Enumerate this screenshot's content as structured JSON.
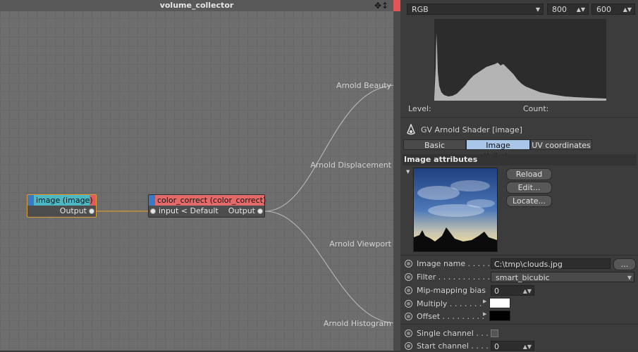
{
  "editor": {
    "title": "volume_collector",
    "outputs": [
      {
        "label": "Arnold Beauty"
      },
      {
        "label": "Arnold Displacement"
      },
      {
        "label": "Arnold Viewport"
      },
      {
        "label": "Arnold Histogram"
      }
    ],
    "nodes": {
      "image": {
        "title": "image (image)",
        "output": "Output"
      },
      "color_correct": {
        "title": "color_correct (color_correct)",
        "input": "input < Default",
        "output": "Output"
      }
    }
  },
  "panel": {
    "channel": "RGB",
    "width": "800",
    "height": "600",
    "level_label": "Level:",
    "count_label": "Count:",
    "shader_title": "GV Arnold Shader [image]",
    "tabs": [
      {
        "label": "Basic"
      },
      {
        "label": "Image attributes",
        "active": true
      },
      {
        "label": "UV coordinates"
      }
    ],
    "section_title": "Image attributes",
    "buttons": {
      "reload": "Reload",
      "edit": "Edit...",
      "locate": "Locate..."
    },
    "params": {
      "image_name": {
        "label": "Image name . . . . . . .",
        "value": "C:\\tmp\\clouds.jpg",
        "browse": "..."
      },
      "filter": {
        "label": "Filter . . . . . . . . . . . . .",
        "value": "smart_bicubic"
      },
      "mip_bias": {
        "label": "Mip-mapping bias",
        "value": "0"
      },
      "multiply": {
        "label": "Multiply . . . . . . .",
        "color": "#ffffff"
      },
      "offset": {
        "label": "Offset . . . . . . . . .",
        "color": "#000000"
      },
      "single_channel": {
        "label": "Single channel . . . ."
      },
      "start_channel": {
        "label": "Start channel . . . . . .",
        "value": "0"
      }
    }
  }
}
